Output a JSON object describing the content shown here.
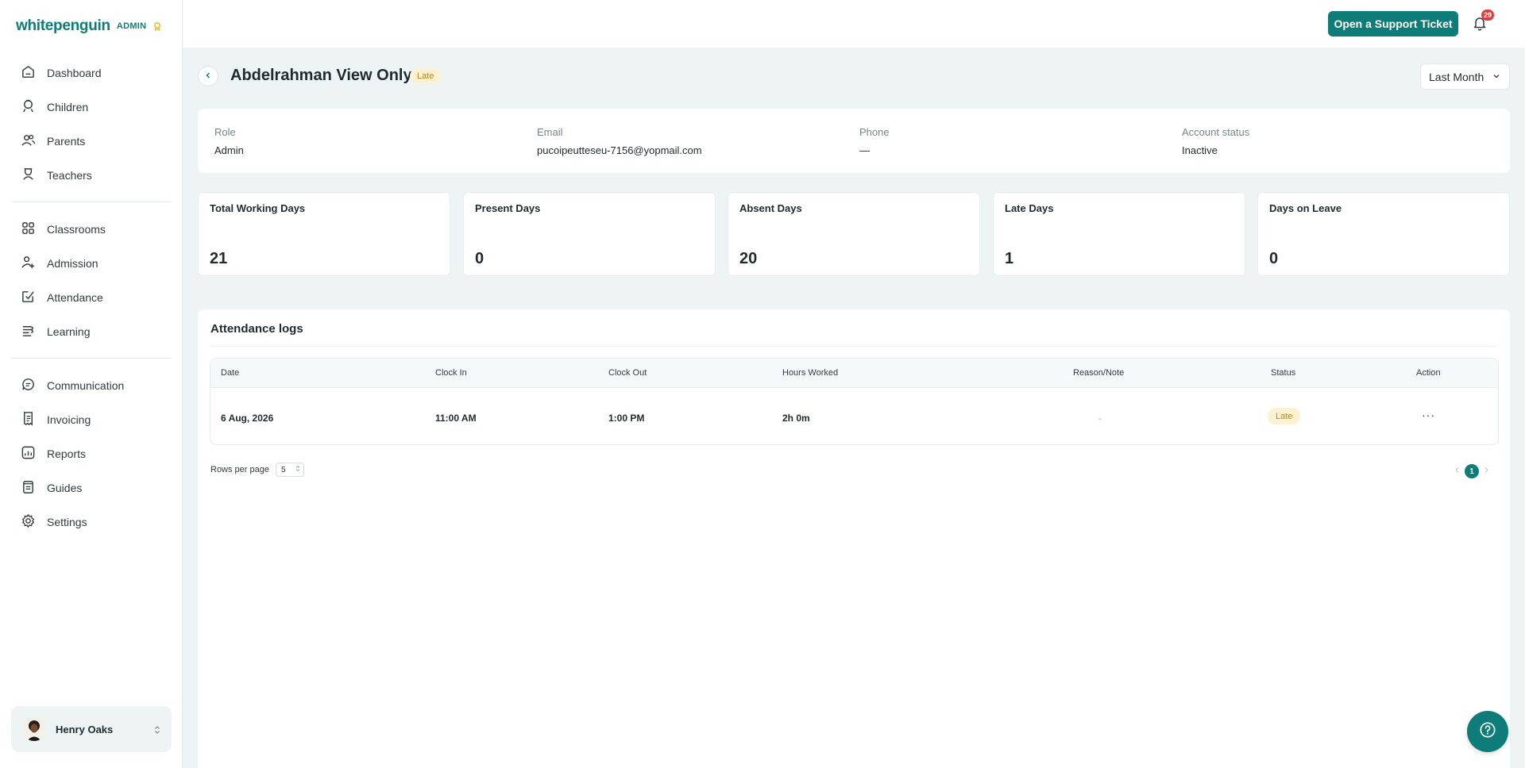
{
  "brand": {
    "logo": "whitepenguin",
    "role": "ADMIN"
  },
  "nav": {
    "group1": [
      {
        "label": "Dashboard",
        "icon": "dashboard-icon"
      },
      {
        "label": "Children",
        "icon": "children-icon"
      },
      {
        "label": "Parents",
        "icon": "parents-icon"
      },
      {
        "label": "Teachers",
        "icon": "teachers-icon"
      }
    ],
    "group2": [
      {
        "label": "Classrooms",
        "icon": "classrooms-icon"
      },
      {
        "label": "Admission",
        "icon": "admission-icon"
      },
      {
        "label": "Attendance",
        "icon": "attendance-icon"
      },
      {
        "label": "Learning",
        "icon": "learning-icon"
      }
    ],
    "group3": [
      {
        "label": "Communication",
        "icon": "communication-icon"
      },
      {
        "label": "Invoicing",
        "icon": "invoicing-icon"
      },
      {
        "label": "Reports",
        "icon": "reports-icon"
      },
      {
        "label": "Guides",
        "icon": "guides-icon"
      },
      {
        "label": "Settings",
        "icon": "settings-icon"
      }
    ]
  },
  "user": {
    "name": "Henry Oaks"
  },
  "topbar": {
    "ticket_label": "Open a Support Ticket",
    "notification_count": "29"
  },
  "header": {
    "title": "Abdelrahman View Only",
    "status": "Late",
    "period": "Last Month"
  },
  "info": {
    "role_label": "Role",
    "role_value": "Admin",
    "email_label": "Email",
    "email_value": "pucoipeutteseu-7156@yopmail.com",
    "phone_label": "Phone",
    "phone_value": "—",
    "account_label": "Account status",
    "account_value": "Inactive"
  },
  "stats": [
    {
      "label": "Total Working Days",
      "value": "21"
    },
    {
      "label": "Present Days",
      "value": "0"
    },
    {
      "label": "Absent Days",
      "value": "20"
    },
    {
      "label": "Late Days",
      "value": "1"
    },
    {
      "label": "Days on Leave",
      "value": "0"
    }
  ],
  "logs": {
    "title": "Attendance logs",
    "columns": [
      "Date",
      "Clock In",
      "Clock Out",
      "Hours Worked",
      "Reason/Note",
      "Status",
      "Action"
    ],
    "rows": [
      {
        "date": "6 Aug, 2026",
        "clock_in": "11:00 AM",
        "clock_out": "1:00 PM",
        "hours": "2h 0m",
        "note": "-",
        "status": "Late",
        "action": "···"
      }
    ],
    "rows_per_page_label": "Rows per page",
    "rows_per_page": "5",
    "current_page": "1"
  },
  "colors": {
    "accent": "#0e7c78",
    "late_bg": "#fcf1d2",
    "late_text": "#b88a1a",
    "badge": "#e03b3b"
  }
}
